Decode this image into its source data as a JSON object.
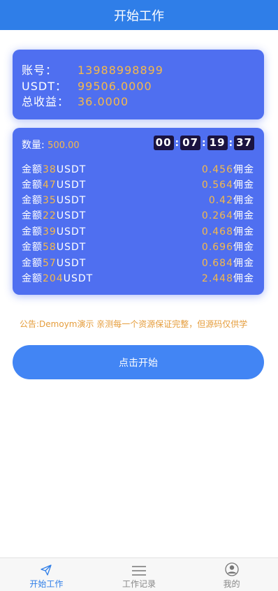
{
  "header": {
    "title": "开始工作"
  },
  "account": {
    "account_label": "账号：",
    "account_value": "13988998899",
    "usdt_label": "USDT：",
    "usdt_value": "99506.0000",
    "earnings_label": "总收益：",
    "earnings_value": "36.0000"
  },
  "work": {
    "qty_label": "数量:",
    "qty_value": "500.00",
    "timer": [
      "00",
      "07",
      "19",
      "37"
    ],
    "rows": [
      {
        "prefix": "金额",
        "amount": "38",
        "unit": "USDT",
        "commission": "0.456",
        "suffix": "佣金"
      },
      {
        "prefix": "金额",
        "amount": "47",
        "unit": "USDT",
        "commission": "0.564",
        "suffix": "佣金"
      },
      {
        "prefix": "金额",
        "amount": "35",
        "unit": "USDT",
        "commission": "0.42",
        "suffix": "佣金"
      },
      {
        "prefix": "金额",
        "amount": "22",
        "unit": "USDT",
        "commission": "0.264",
        "suffix": "佣金"
      },
      {
        "prefix": "金额",
        "amount": "39",
        "unit": "USDT",
        "commission": "0.468",
        "suffix": "佣金"
      },
      {
        "prefix": "金额",
        "amount": "58",
        "unit": "USDT",
        "commission": "0.696",
        "suffix": "佣金"
      },
      {
        "prefix": "金额",
        "amount": "57",
        "unit": "USDT",
        "commission": "0.684",
        "suffix": "佣金"
      },
      {
        "prefix": "金额",
        "amount": "204",
        "unit": "USDT",
        "commission": "2.448",
        "suffix": "佣金"
      }
    ]
  },
  "notice": {
    "text": "公告:Demoym演示 亲测每一个资源保证完整，但源码仅供学"
  },
  "start_button": {
    "label": "点击开始"
  },
  "tabbar": {
    "items": [
      {
        "label": "开始工作",
        "icon": "paper-plane-icon",
        "active": true
      },
      {
        "label": "工作记录",
        "icon": "list-icon",
        "active": false
      },
      {
        "label": "我的",
        "icon": "user-icon",
        "active": false
      }
    ]
  },
  "colors": {
    "primary": "#2f7ee8",
    "card": "#4f6ff0",
    "highlight": "#f6b94a",
    "button": "#4285f4",
    "notice": "#e59d3c"
  }
}
